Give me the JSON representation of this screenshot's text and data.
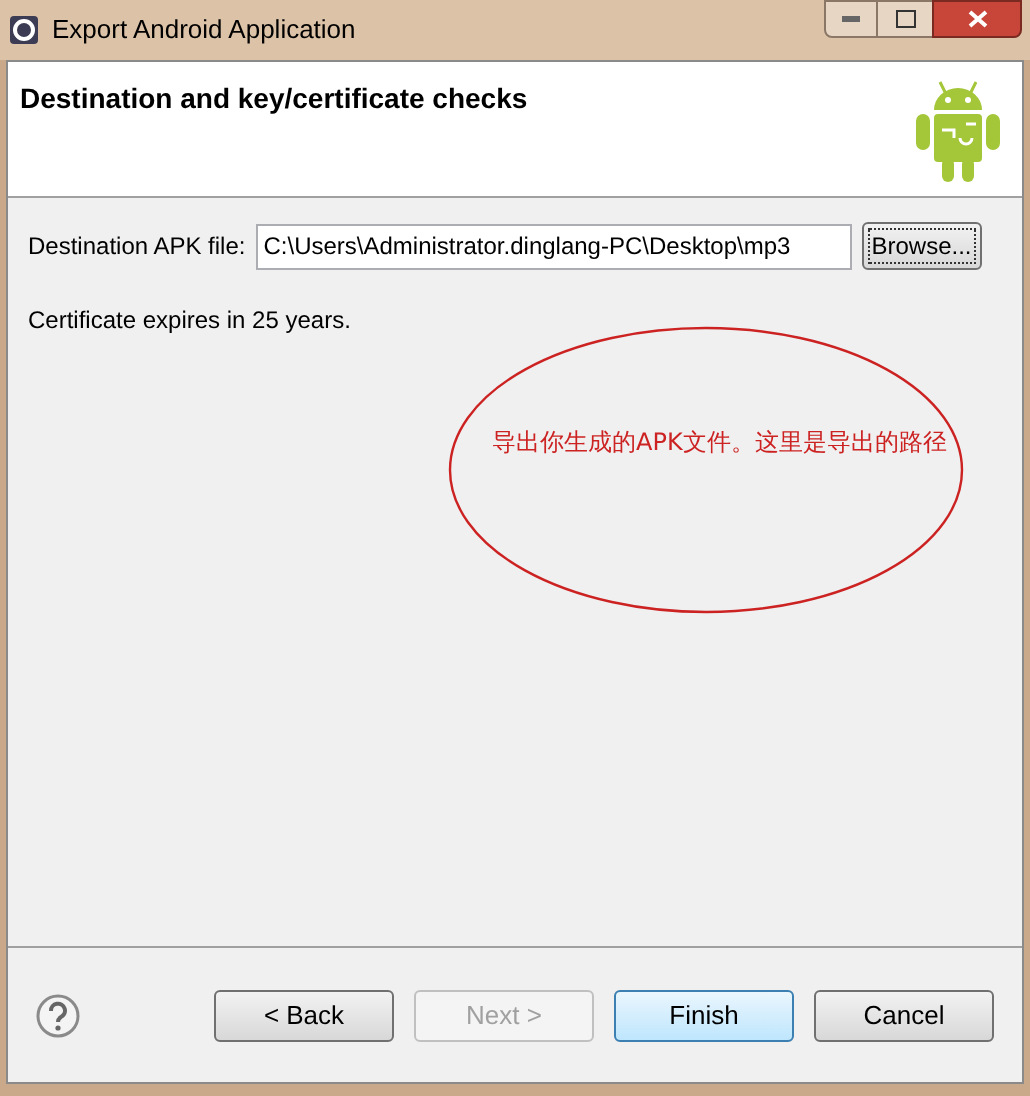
{
  "window": {
    "title": "Export Android Application"
  },
  "header": {
    "title": "Destination and key/certificate checks"
  },
  "destination": {
    "label": "Destination APK file:",
    "value": "C:\\Users\\Administrator.dinglang-PC\\Desktop\\mp3",
    "browse": "Browse..."
  },
  "message": "Certificate expires in 25 years.",
  "annotation": {
    "text": "导出你生成的APK文件。这里是导出的路径",
    "color": "#cc2222"
  },
  "buttons": [
    {
      "label": "< Back",
      "disabled": false,
      "default": false
    },
    {
      "label": "Next >",
      "disabled": true,
      "default": false
    },
    {
      "label": "Finish",
      "disabled": false,
      "default": true
    },
    {
      "label": "Cancel",
      "disabled": false,
      "default": false
    }
  ]
}
